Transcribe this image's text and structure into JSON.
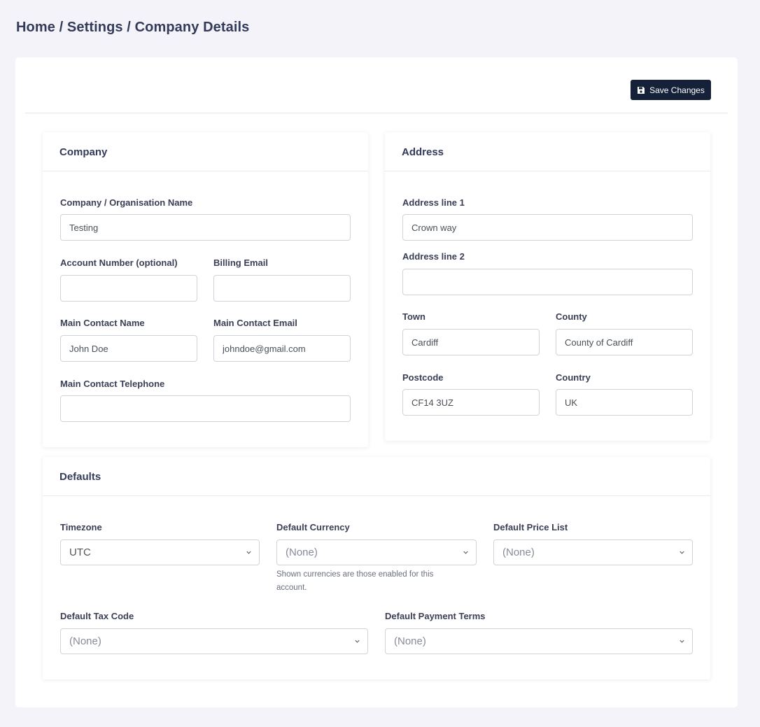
{
  "breadcrumb": "Home / Settings / Company Details",
  "toolbar": {
    "save_label": "Save Changes",
    "save_icon": "floppy-disk-icon"
  },
  "company": {
    "title": "Company",
    "name_label": "Company / Organisation Name",
    "name_value": "Testing",
    "account_label": "Account Number (optional)",
    "account_value": "",
    "billing_label": "Billing Email",
    "billing_value": "",
    "contact_name_label": "Main Contact Name",
    "contact_name_value": "John Doe",
    "contact_email_label": "Main Contact Email",
    "contact_email_value": "johndoe@gmail.com",
    "telephone_label": "Main Contact Telephone",
    "telephone_value": ""
  },
  "address": {
    "title": "Address",
    "line1_label": "Address line 1",
    "line1_value": "Crown way",
    "line2_label": "Address line 2",
    "line2_value": "",
    "town_label": "Town",
    "town_value": "Cardiff",
    "county_label": "County",
    "county_value": "County of Cardiff",
    "postcode_label": "Postcode",
    "postcode_value": "CF14 3UZ",
    "country_label": "Country",
    "country_value": "UK"
  },
  "defaults": {
    "title": "Defaults",
    "timezone_label": "Timezone",
    "timezone_value": "UTC",
    "currency_label": "Default Currency",
    "currency_value": "(None)",
    "currency_help": "Shown currencies are those enabled for this account.",
    "pricelist_label": "Default Price List",
    "pricelist_value": "(None)",
    "taxcode_label": "Default Tax Code",
    "taxcode_value": "(None)",
    "payterms_label": "Default Payment Terms",
    "payterms_value": "(None)"
  },
  "colors": {
    "primary_button": "#152138",
    "background": "#f3f3f9"
  }
}
